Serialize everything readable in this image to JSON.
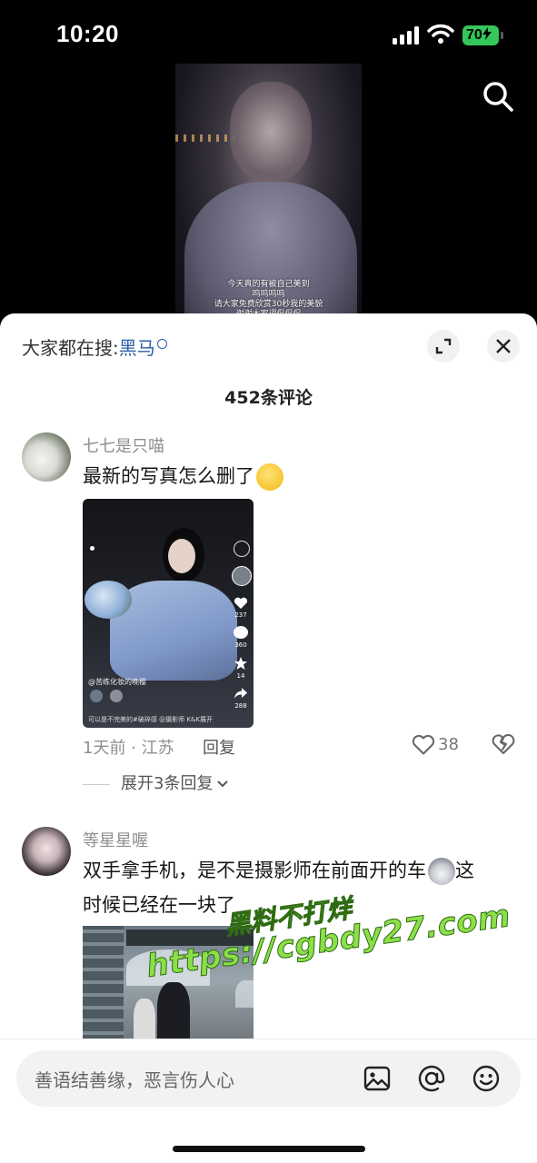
{
  "status_bar": {
    "time": "10:20",
    "battery": "70"
  },
  "video": {
    "caption_lines": [
      "今天真的有被自己美到",
      "呜呜呜呜",
      "请大家免费欣赏30秒我的美貌",
      "谢谢大家调侃侃侃"
    ]
  },
  "sheet": {
    "trending_prefix": "大家都在搜:",
    "trending_keyword": "黑马",
    "comment_count": "452条评论"
  },
  "comments": [
    {
      "username": "七七是只喵",
      "text": "最新的写真怎么删了",
      "photo_overlay": {
        "author": "@苦练化妆的晚樱",
        "caption": "可以是不完美的#破碎感 @摄影师 K&K展开",
        "likes": "237",
        "comments": "360",
        "favorites": "14",
        "shares": "288"
      },
      "meta": "1天前 · 江苏",
      "reply": "回复",
      "likes": "38",
      "expand_replies": "展开3条回复"
    },
    {
      "username": "等星星喔",
      "text_line1": "双手拿手机，是不是摄影师在前面开的车",
      "text_line1_tail": "这",
      "text_line2": "时候已经在一块了"
    }
  ],
  "watermark": {
    "line1": "黑料不打烊",
    "line2": "https://cgbdy27.com"
  },
  "input": {
    "placeholder": "善语结善缘，恶言伤人心"
  },
  "colors": {
    "accent_link": "#2b5ea8",
    "battery": "#34c759",
    "watermark": "#8be04a"
  }
}
